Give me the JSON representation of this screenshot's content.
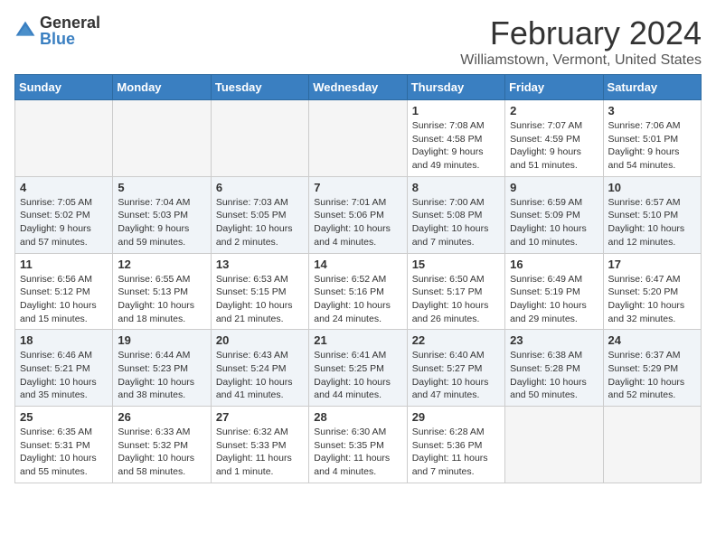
{
  "logo": {
    "general": "General",
    "blue": "Blue"
  },
  "title": "February 2024",
  "subtitle": "Williamstown, Vermont, United States",
  "days_of_week": [
    "Sunday",
    "Monday",
    "Tuesday",
    "Wednesday",
    "Thursday",
    "Friday",
    "Saturday"
  ],
  "weeks": [
    [
      {
        "day": "",
        "info": ""
      },
      {
        "day": "",
        "info": ""
      },
      {
        "day": "",
        "info": ""
      },
      {
        "day": "",
        "info": ""
      },
      {
        "day": "1",
        "info": "Sunrise: 7:08 AM\nSunset: 4:58 PM\nDaylight: 9 hours\nand 49 minutes."
      },
      {
        "day": "2",
        "info": "Sunrise: 7:07 AM\nSunset: 4:59 PM\nDaylight: 9 hours\nand 51 minutes."
      },
      {
        "day": "3",
        "info": "Sunrise: 7:06 AM\nSunset: 5:01 PM\nDaylight: 9 hours\nand 54 minutes."
      }
    ],
    [
      {
        "day": "4",
        "info": "Sunrise: 7:05 AM\nSunset: 5:02 PM\nDaylight: 9 hours\nand 57 minutes."
      },
      {
        "day": "5",
        "info": "Sunrise: 7:04 AM\nSunset: 5:03 PM\nDaylight: 9 hours\nand 59 minutes."
      },
      {
        "day": "6",
        "info": "Sunrise: 7:03 AM\nSunset: 5:05 PM\nDaylight: 10 hours\nand 2 minutes."
      },
      {
        "day": "7",
        "info": "Sunrise: 7:01 AM\nSunset: 5:06 PM\nDaylight: 10 hours\nand 4 minutes."
      },
      {
        "day": "8",
        "info": "Sunrise: 7:00 AM\nSunset: 5:08 PM\nDaylight: 10 hours\nand 7 minutes."
      },
      {
        "day": "9",
        "info": "Sunrise: 6:59 AM\nSunset: 5:09 PM\nDaylight: 10 hours\nand 10 minutes."
      },
      {
        "day": "10",
        "info": "Sunrise: 6:57 AM\nSunset: 5:10 PM\nDaylight: 10 hours\nand 12 minutes."
      }
    ],
    [
      {
        "day": "11",
        "info": "Sunrise: 6:56 AM\nSunset: 5:12 PM\nDaylight: 10 hours\nand 15 minutes."
      },
      {
        "day": "12",
        "info": "Sunrise: 6:55 AM\nSunset: 5:13 PM\nDaylight: 10 hours\nand 18 minutes."
      },
      {
        "day": "13",
        "info": "Sunrise: 6:53 AM\nSunset: 5:15 PM\nDaylight: 10 hours\nand 21 minutes."
      },
      {
        "day": "14",
        "info": "Sunrise: 6:52 AM\nSunset: 5:16 PM\nDaylight: 10 hours\nand 24 minutes."
      },
      {
        "day": "15",
        "info": "Sunrise: 6:50 AM\nSunset: 5:17 PM\nDaylight: 10 hours\nand 26 minutes."
      },
      {
        "day": "16",
        "info": "Sunrise: 6:49 AM\nSunset: 5:19 PM\nDaylight: 10 hours\nand 29 minutes."
      },
      {
        "day": "17",
        "info": "Sunrise: 6:47 AM\nSunset: 5:20 PM\nDaylight: 10 hours\nand 32 minutes."
      }
    ],
    [
      {
        "day": "18",
        "info": "Sunrise: 6:46 AM\nSunset: 5:21 PM\nDaylight: 10 hours\nand 35 minutes."
      },
      {
        "day": "19",
        "info": "Sunrise: 6:44 AM\nSunset: 5:23 PM\nDaylight: 10 hours\nand 38 minutes."
      },
      {
        "day": "20",
        "info": "Sunrise: 6:43 AM\nSunset: 5:24 PM\nDaylight: 10 hours\nand 41 minutes."
      },
      {
        "day": "21",
        "info": "Sunrise: 6:41 AM\nSunset: 5:25 PM\nDaylight: 10 hours\nand 44 minutes."
      },
      {
        "day": "22",
        "info": "Sunrise: 6:40 AM\nSunset: 5:27 PM\nDaylight: 10 hours\nand 47 minutes."
      },
      {
        "day": "23",
        "info": "Sunrise: 6:38 AM\nSunset: 5:28 PM\nDaylight: 10 hours\nand 50 minutes."
      },
      {
        "day": "24",
        "info": "Sunrise: 6:37 AM\nSunset: 5:29 PM\nDaylight: 10 hours\nand 52 minutes."
      }
    ],
    [
      {
        "day": "25",
        "info": "Sunrise: 6:35 AM\nSunset: 5:31 PM\nDaylight: 10 hours\nand 55 minutes."
      },
      {
        "day": "26",
        "info": "Sunrise: 6:33 AM\nSunset: 5:32 PM\nDaylight: 10 hours\nand 58 minutes."
      },
      {
        "day": "27",
        "info": "Sunrise: 6:32 AM\nSunset: 5:33 PM\nDaylight: 11 hours\nand 1 minute."
      },
      {
        "day": "28",
        "info": "Sunrise: 6:30 AM\nSunset: 5:35 PM\nDaylight: 11 hours\nand 4 minutes."
      },
      {
        "day": "29",
        "info": "Sunrise: 6:28 AM\nSunset: 5:36 PM\nDaylight: 11 hours\nand 7 minutes."
      },
      {
        "day": "",
        "info": ""
      },
      {
        "day": "",
        "info": ""
      }
    ]
  ]
}
